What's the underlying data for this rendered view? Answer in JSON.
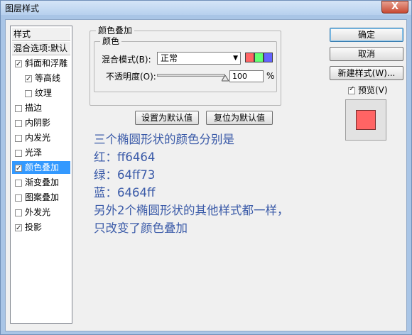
{
  "window": {
    "title": "图层样式",
    "close_label": "X"
  },
  "sidebar": {
    "items": [
      {
        "label": "样式",
        "checkbox": false,
        "checked": false,
        "sub": false,
        "selected": false,
        "header": true
      },
      {
        "label": "混合选项:默认",
        "checkbox": false,
        "checked": false,
        "sub": false,
        "selected": false,
        "header": true
      },
      {
        "label": "斜面和浮雕",
        "checkbox": true,
        "checked": true,
        "sub": false,
        "selected": false
      },
      {
        "label": "等高线",
        "checkbox": true,
        "checked": true,
        "sub": true,
        "selected": false
      },
      {
        "label": "纹理",
        "checkbox": true,
        "checked": false,
        "sub": true,
        "selected": false
      },
      {
        "label": "描边",
        "checkbox": true,
        "checked": false,
        "sub": false,
        "selected": false
      },
      {
        "label": "内阴影",
        "checkbox": true,
        "checked": false,
        "sub": false,
        "selected": false
      },
      {
        "label": "内发光",
        "checkbox": true,
        "checked": false,
        "sub": false,
        "selected": false
      },
      {
        "label": "光泽",
        "checkbox": true,
        "checked": false,
        "sub": false,
        "selected": false
      },
      {
        "label": "颜色叠加",
        "checkbox": true,
        "checked": true,
        "sub": false,
        "selected": true
      },
      {
        "label": "渐变叠加",
        "checkbox": true,
        "checked": false,
        "sub": false,
        "selected": false
      },
      {
        "label": "图案叠加",
        "checkbox": true,
        "checked": false,
        "sub": false,
        "selected": false
      },
      {
        "label": "外发光",
        "checkbox": true,
        "checked": false,
        "sub": false,
        "selected": false
      },
      {
        "label": "投影",
        "checkbox": true,
        "checked": true,
        "sub": false,
        "selected": false
      }
    ]
  },
  "color_overlay": {
    "group_title": "颜色叠加",
    "subgroup_title": "颜色",
    "blend_mode_label": "混合模式(B):",
    "blend_mode_value": "正常",
    "swatch_colors": [
      "#ff6464",
      "#64ff73",
      "#6464ff"
    ],
    "opacity_label": "不透明度(O):",
    "opacity_value": "100",
    "opacity_unit": "%",
    "opacity_fraction": 1.0,
    "set_default_label": "设置为默认值",
    "reset_default_label": "复位为默认值"
  },
  "annotation": {
    "lines": [
      "三个椭圆形状的颜色分别是",
      "红：ff6464",
      "绿：64ff73",
      "蓝：6464ff",
      "另外2个椭圆形状的其他样式都一样，",
      "只改变了颜色叠加"
    ],
    "color": "#3a5aa8"
  },
  "actions": {
    "ok_label": "确定",
    "cancel_label": "取消",
    "new_style_label": "新建样式(W)...",
    "preview_label": "预览(V)",
    "preview_checked": true,
    "preview_color": "#ff6464"
  }
}
